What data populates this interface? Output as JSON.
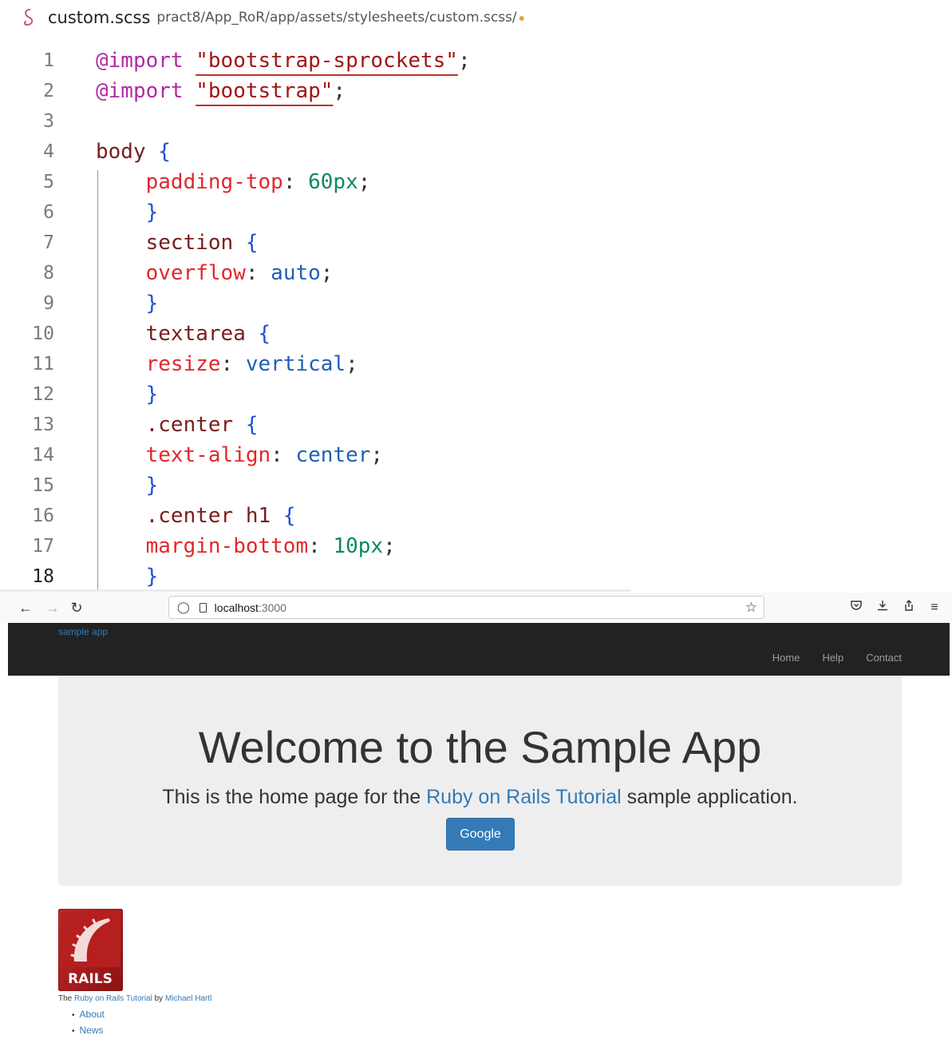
{
  "editor": {
    "file_name": "custom.scss",
    "file_path": "pract8/App_RoR/app/assets/stylesheets/custom.scss/",
    "current_line": 18,
    "lines": [
      {
        "n": "1",
        "tokens": [
          {
            "c": "t-at",
            "t": "@import"
          },
          {
            "c": "t-punc",
            "t": " "
          },
          {
            "c": "t-str",
            "t": "\"bootstrap-sprockets\""
          },
          {
            "c": "t-punc",
            "t": ";"
          }
        ]
      },
      {
        "n": "2",
        "tokens": [
          {
            "c": "t-at",
            "t": "@import"
          },
          {
            "c": "t-punc",
            "t": " "
          },
          {
            "c": "t-str",
            "t": "\"bootstrap\""
          },
          {
            "c": "t-punc",
            "t": ";"
          }
        ]
      },
      {
        "n": "3",
        "tokens": []
      },
      {
        "n": "4",
        "tokens": [
          {
            "c": "t-sel",
            "t": "body"
          },
          {
            "c": "t-punc",
            "t": " "
          },
          {
            "c": "t-brace",
            "t": "{"
          }
        ]
      },
      {
        "n": "5",
        "tokens": [
          {
            "c": "t-punc",
            "t": "    "
          },
          {
            "c": "t-prop",
            "t": "padding-top"
          },
          {
            "c": "t-punc",
            "t": ": "
          },
          {
            "c": "t-num",
            "t": "60px"
          },
          {
            "c": "t-punc",
            "t": ";"
          }
        ]
      },
      {
        "n": "6",
        "tokens": [
          {
            "c": "t-punc",
            "t": "    "
          },
          {
            "c": "t-brace",
            "t": "}"
          }
        ]
      },
      {
        "n": "7",
        "tokens": [
          {
            "c": "t-punc",
            "t": "    "
          },
          {
            "c": "t-sel",
            "t": "section"
          },
          {
            "c": "t-punc",
            "t": " "
          },
          {
            "c": "t-brace",
            "t": "{"
          }
        ]
      },
      {
        "n": "8",
        "tokens": [
          {
            "c": "t-punc",
            "t": "    "
          },
          {
            "c": "t-prop",
            "t": "overflow"
          },
          {
            "c": "t-punc",
            "t": ": "
          },
          {
            "c": "t-kw",
            "t": "auto"
          },
          {
            "c": "t-punc",
            "t": ";"
          }
        ]
      },
      {
        "n": "9",
        "tokens": [
          {
            "c": "t-punc",
            "t": "    "
          },
          {
            "c": "t-brace",
            "t": "}"
          }
        ]
      },
      {
        "n": "10",
        "tokens": [
          {
            "c": "t-punc",
            "t": "    "
          },
          {
            "c": "t-sel",
            "t": "textarea"
          },
          {
            "c": "t-punc",
            "t": " "
          },
          {
            "c": "t-brace",
            "t": "{"
          }
        ]
      },
      {
        "n": "11",
        "tokens": [
          {
            "c": "t-punc",
            "t": "    "
          },
          {
            "c": "t-prop",
            "t": "resize"
          },
          {
            "c": "t-punc",
            "t": ": "
          },
          {
            "c": "t-kw",
            "t": "vertical"
          },
          {
            "c": "t-punc",
            "t": ";"
          }
        ]
      },
      {
        "n": "12",
        "tokens": [
          {
            "c": "t-punc",
            "t": "    "
          },
          {
            "c": "t-brace",
            "t": "}"
          }
        ]
      },
      {
        "n": "13",
        "tokens": [
          {
            "c": "t-punc",
            "t": "    "
          },
          {
            "c": "t-sel",
            "t": ".center"
          },
          {
            "c": "t-punc",
            "t": " "
          },
          {
            "c": "t-brace",
            "t": "{"
          }
        ]
      },
      {
        "n": "14",
        "tokens": [
          {
            "c": "t-punc",
            "t": "    "
          },
          {
            "c": "t-prop",
            "t": "text-align"
          },
          {
            "c": "t-punc",
            "t": ": "
          },
          {
            "c": "t-kw",
            "t": "center"
          },
          {
            "c": "t-punc",
            "t": ";"
          }
        ]
      },
      {
        "n": "15",
        "tokens": [
          {
            "c": "t-punc",
            "t": "    "
          },
          {
            "c": "t-brace",
            "t": "}"
          }
        ]
      },
      {
        "n": "16",
        "tokens": [
          {
            "c": "t-punc",
            "t": "    "
          },
          {
            "c": "t-sel",
            "t": ".center h1"
          },
          {
            "c": "t-punc",
            "t": " "
          },
          {
            "c": "t-brace",
            "t": "{"
          }
        ]
      },
      {
        "n": "17",
        "tokens": [
          {
            "c": "t-punc",
            "t": "    "
          },
          {
            "c": "t-prop",
            "t": "margin-bottom"
          },
          {
            "c": "t-punc",
            "t": ": "
          },
          {
            "c": "t-num",
            "t": "10px"
          },
          {
            "c": "t-punc",
            "t": ";"
          }
        ]
      },
      {
        "n": "18",
        "tokens": [
          {
            "c": "t-punc",
            "t": "    "
          },
          {
            "c": "t-brace",
            "t": "}"
          }
        ]
      }
    ]
  },
  "browser": {
    "url_host": "localhost",
    "url_port": ":3000",
    "icons": {
      "back": "back-arrow-icon",
      "forward": "forward-arrow-icon",
      "reload": "reload-icon",
      "bookmark": "star-icon",
      "pocket": "pocket-icon",
      "downloads": "download-icon",
      "share": "share-icon",
      "menu": "hamburger-menu-icon"
    }
  },
  "app": {
    "logo": "sample app",
    "nav": [
      "Home",
      "Help",
      "Contact"
    ],
    "heading": "Welcome to the Sample App",
    "tagline_before": "This is the home page for the ",
    "tagline_link": "Ruby on Rails Tutorial",
    "tagline_after": " sample application.",
    "button": "Google",
    "rails_logo_text": "RAILS",
    "footer": {
      "prefix": "The ",
      "tutorial_link": "Ruby on Rails Tutorial",
      "by": " by ",
      "author_link": "Michael Hartl",
      "links": [
        "About",
        "News"
      ]
    },
    "colors": {
      "navbar": "#222222",
      "jumbotron": "#eeeeee",
      "link": "#337ab7",
      "button": "#337ab7"
    }
  }
}
